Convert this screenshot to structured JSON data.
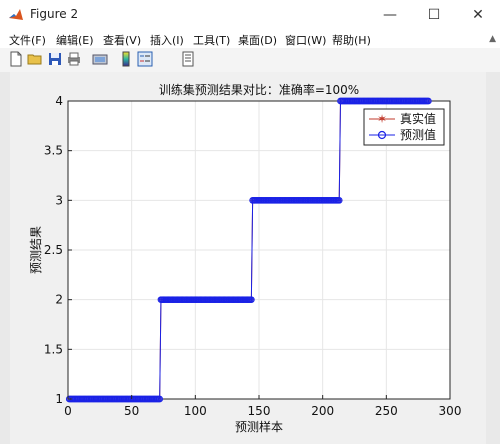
{
  "window": {
    "title": "Figure 2",
    "minimize": "—",
    "maximize": "☐",
    "close": "✕"
  },
  "menu": [
    {
      "label": "文件(F)"
    },
    {
      "label": "编辑(E)"
    },
    {
      "label": "查看(V)"
    },
    {
      "label": "插入(I)"
    },
    {
      "label": "工具(T)"
    },
    {
      "label": "桌面(D)"
    },
    {
      "label": "窗口(W)"
    },
    {
      "label": "帮助(H)"
    }
  ],
  "toolbar": {
    "icons": [
      "new-figure-icon",
      "open-file-icon",
      "save-icon",
      "print-icon",
      "link-plot-icon",
      "colorbar-icon",
      "legend-icon",
      "property-inspector-icon"
    ]
  },
  "chart_data": {
    "type": "line",
    "title": "训练集预测结果对比：准确率=100%",
    "xlabel": "预测样本",
    "ylabel": "预测结果",
    "xlim": [
      0,
      300
    ],
    "ylim": [
      1,
      4
    ],
    "xticks": [
      "0",
      "50",
      "100",
      "150",
      "200",
      "250",
      "300"
    ],
    "yticks": [
      "1",
      "1.5",
      "2",
      "2.5",
      "3",
      "3.5",
      "4"
    ],
    "grid": true,
    "legend_position": "top-right",
    "series": [
      {
        "name": "真实值",
        "color": "#c0392b",
        "marker": "*",
        "steps": [
          [
            1,
            72,
            1
          ],
          [
            73,
            144,
            2
          ],
          [
            145,
            213,
            3
          ],
          [
            214,
            283,
            4
          ]
        ]
      },
      {
        "name": "预测值",
        "color": "#1a22e6",
        "marker": "o",
        "steps": [
          [
            1,
            72,
            1
          ],
          [
            73,
            144,
            2
          ],
          [
            145,
            213,
            3
          ],
          [
            214,
            283,
            4
          ]
        ]
      }
    ]
  }
}
